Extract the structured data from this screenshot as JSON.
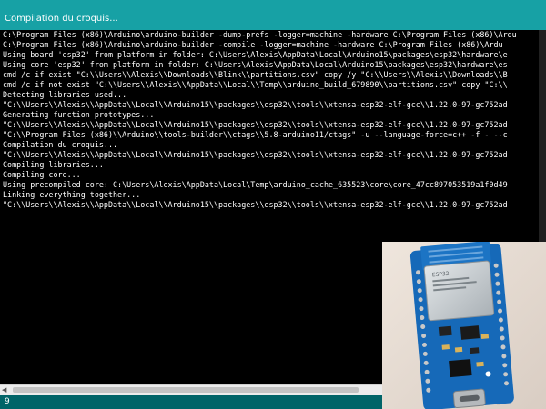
{
  "status": {
    "text": "Compilation du croquis..."
  },
  "console": {
    "lines": [
      "C:\\Program Files (x86)\\Arduino\\arduino-builder -dump-prefs -logger=machine -hardware C:\\Program Files (x86)\\Ardu",
      "C:\\Program Files (x86)\\Arduino\\arduino-builder -compile -logger=machine -hardware C:\\Program Files (x86)\\Ardu",
      "Using board 'esp32' from platform in folder: C:\\Users\\Alexis\\AppData\\Local\\Arduino15\\packages\\esp32\\hardware\\e",
      "Using core 'esp32' from platform in folder: C:\\Users\\Alexis\\AppData\\Local\\Arduino15\\packages\\esp32\\hardware\\es",
      "cmd /c if exist \"C:\\\\Users\\\\Alexis\\\\Downloads\\\\Blink\\\\partitions.csv\" copy /y \"C:\\\\Users\\\\Alexis\\\\Downloads\\\\B",
      "cmd /c if not exist \"C:\\\\Users\\\\Alexis\\\\AppData\\\\Local\\\\Temp\\\\arduino_build_679890\\\\partitions.csv\" copy \"C:\\\\",
      "Detecting libraries used...",
      "\"C:\\\\Users\\\\Alexis\\\\AppData\\\\Local\\\\Arduino15\\\\packages\\\\esp32\\\\tools\\\\xtensa-esp32-elf-gcc\\\\1.22.0-97-gc752ad",
      "Generating function prototypes...",
      "\"C:\\\\Users\\\\Alexis\\\\AppData\\\\Local\\\\Arduino15\\\\packages\\\\esp32\\\\tools\\\\xtensa-esp32-elf-gcc\\\\1.22.0-97-gc752ad",
      "\"C:\\\\Program Files (x86)\\\\Arduino\\\\tools-builder\\\\ctags\\\\5.8-arduino11/ctags\" -u --language-force=c++ -f - --c",
      "Compilation du croquis...",
      "\"C:\\\\Users\\\\Alexis\\\\AppData\\\\Local\\\\Arduino15\\\\packages\\\\esp32\\\\tools\\\\xtensa-esp32-elf-gcc\\\\1.22.0-97-gc752ad",
      "Compiling libraries...",
      "Compiling core...",
      "Using precompiled core: C:\\Users\\Alexis\\AppData\\Local\\Temp\\arduino_cache_635523\\core\\core_47cc897053519a1f0d49",
      "Linking everything together...",
      "\"C:\\\\Users\\\\Alexis\\\\AppData\\\\Local\\\\Arduino15\\\\packages\\\\esp32\\\\tools\\\\xtensa-esp32-elf-gcc\\\\1.22.0-97-gc752ad"
    ]
  },
  "footer": {
    "line_number": "9"
  },
  "photo": {
    "module_text": "ESP32",
    "colors": {
      "board": "#1669b8",
      "shield": "#cdd3d6",
      "background": "#e8ddd4"
    }
  },
  "colors": {
    "status_bar": "#17a1a5",
    "footer_bar": "#006468",
    "console_bg": "#000000",
    "console_text": "#ffffff"
  }
}
